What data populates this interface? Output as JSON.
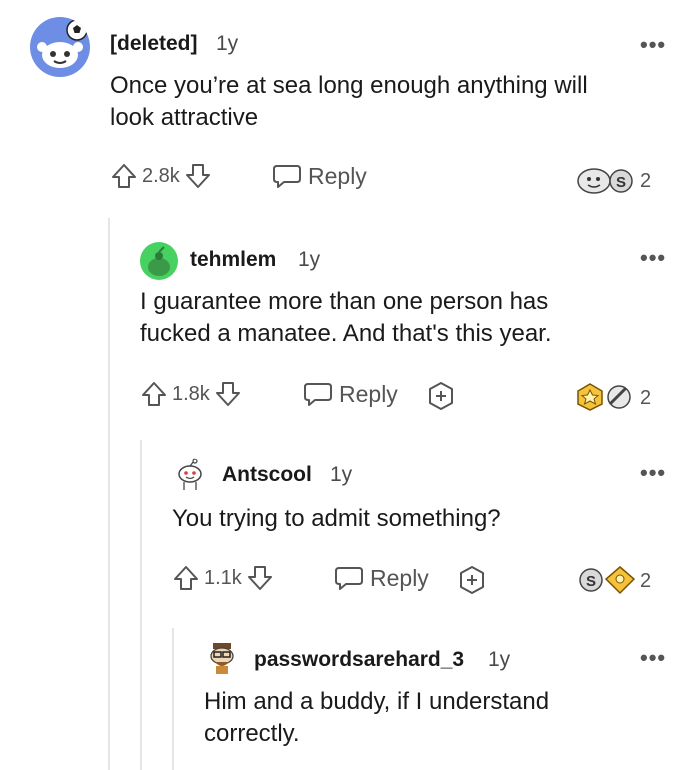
{
  "comments": [
    {
      "username": "[deleted]",
      "age": "1y",
      "text_line1": "Once you’re at sea long enough anything will",
      "text_line2": "look attractive",
      "votes": "2.8k",
      "reply_label": "Reply",
      "awards_count": "2"
    },
    {
      "username": "tehmlem",
      "age": "1y",
      "text_line1": "I guarantee more than one person has",
      "text_line2": "fucked a manatee. And that's this year.",
      "votes": "1.8k",
      "reply_label": "Reply",
      "awards_count": "2"
    },
    {
      "username": "Antscool",
      "age": "1y",
      "text_line1": "You trying to admit something?",
      "votes": "1.1k",
      "reply_label": "Reply",
      "awards_count": "2"
    },
    {
      "username": "passwordsarehard_3",
      "age": "1y",
      "text_line1": "Him and a buddy, if I understand",
      "text_line2": "correctly."
    }
  ],
  "more_icon": "more-dots-icon",
  "colors": {
    "avatar1_bg": "#6e8ee6",
    "avatar2_bg": "#46d160",
    "text": "#1a1a1b",
    "meta": "#555555"
  }
}
